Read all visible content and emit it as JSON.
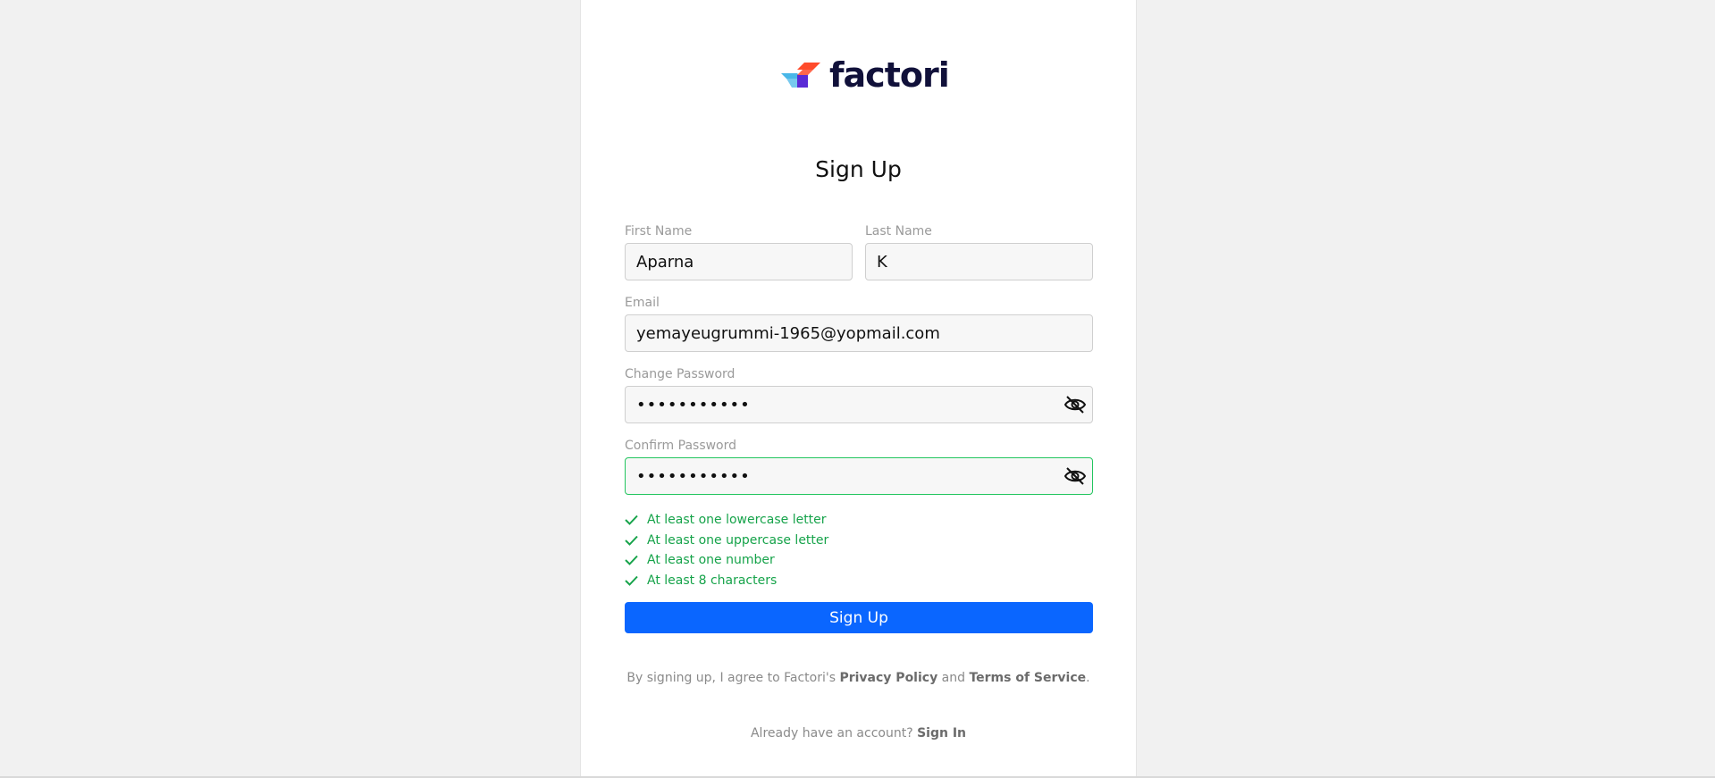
{
  "brand": {
    "name": "factori",
    "logo_colors": [
      "#ff4b2b",
      "#5a2bd6",
      "#49b7e8"
    ]
  },
  "form": {
    "title": "Sign Up",
    "first_name": {
      "label": "First Name",
      "value": "Aparna"
    },
    "last_name": {
      "label": "Last Name",
      "value": "K"
    },
    "email": {
      "label": "Email",
      "value": "yemayeugrummi-1965@yopmail.com"
    },
    "password": {
      "label": "Change Password",
      "masked_value": "•••••••••••",
      "icon": "eye-off-icon"
    },
    "confirm_password": {
      "label": "Confirm Password",
      "masked_value": "•••••••••••",
      "icon": "eye-off-icon",
      "status": "valid"
    },
    "rules": [
      {
        "text": "At least one lowercase letter",
        "met": true
      },
      {
        "text": "At least one uppercase letter",
        "met": true
      },
      {
        "text": "At least one number",
        "met": true
      },
      {
        "text": "At least 8 characters",
        "met": true
      }
    ],
    "submit_label": "Sign Up"
  },
  "terms": {
    "prefix": "By signing up, I agree to Factori's ",
    "privacy": "Privacy Policy",
    "and": " and ",
    "tos": "Terms of Service",
    "suffix": "."
  },
  "signin": {
    "prefix": "Already have an account? ",
    "link": "Sign In"
  },
  "colors": {
    "primary": "#0a66ff",
    "success": "#16a34a",
    "valid_border": "#22c55e"
  }
}
